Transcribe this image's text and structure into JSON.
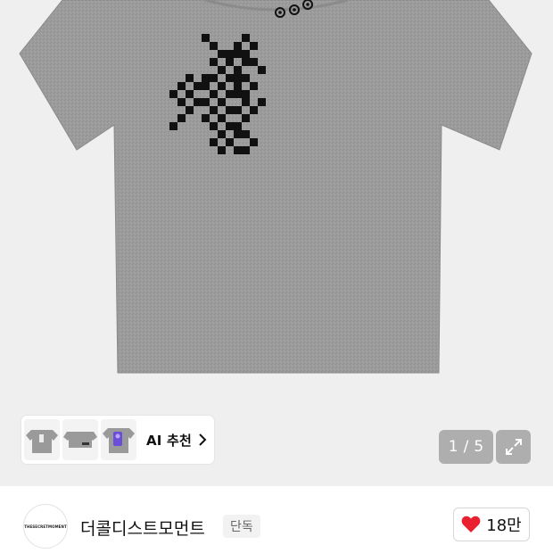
{
  "hero": {
    "image_alt": "grey t-shirt with black pixel graphic print"
  },
  "ai_recommend": {
    "label": "AI 추천",
    "thumb_logo_text": "THESECRETMOMENT"
  },
  "gallery": {
    "current": "1",
    "separator": "/",
    "total": "5"
  },
  "brand": {
    "avatar_text": "THESECRETMOMENT",
    "name": "더콜디스트모먼트",
    "badge": "단독"
  },
  "like": {
    "count": "18만"
  },
  "colors": {
    "shirt": "#9a9a9a",
    "print": "#111111",
    "like_heart": "#e8202f",
    "overlay": "#787878"
  }
}
